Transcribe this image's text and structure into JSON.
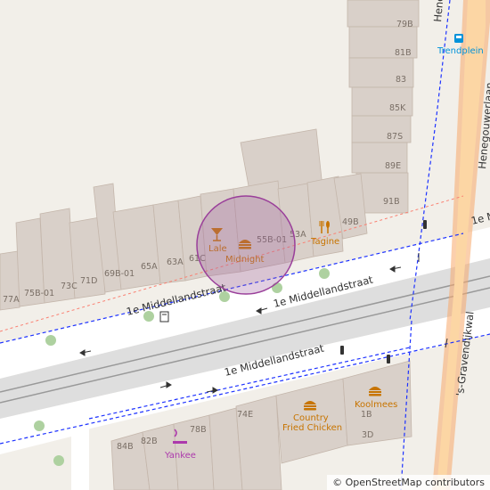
{
  "map": {
    "streets": {
      "middellandstraat_top_left": "1e Middellandstraat",
      "middellandstraat_top_mid": "1e Middellandstraat",
      "middellandstraat_bottom": "1e Middellandstraat",
      "middellandstraat_right": "1e M",
      "henegouwerlaan": "Henegouwerlaan",
      "henegouwerlaan_top": "Hene",
      "s_gravendijkwal": "'s-Gravendijkwal"
    },
    "house_numbers": {
      "n79B": "79B",
      "n81B": "81B",
      "n83": "83",
      "n85K": "85K",
      "n87S": "87S",
      "n89E": "89E",
      "n91B": "91B",
      "n49B": "49B",
      "n53A": "53A",
      "n55B01": "55B-01",
      "n61C": "61C",
      "n63A": "63A",
      "n65A": "65A",
      "n69B01": "69B-01",
      "n71D": "71D",
      "n73C": "73C",
      "n75B01": "75B-01",
      "n77A": "77A",
      "n74E": "74E",
      "n78B": "78B",
      "n82B": "82B",
      "n84B": "84B",
      "n1B": "1B",
      "n3D": "3D"
    },
    "pois": {
      "lale": "Lale",
      "midnight": "Midnight",
      "tagine": "Tagine",
      "trendplein": "Trendplein",
      "country_fried_chicken_1": "Country",
      "country_fried_chicken_2": "Fried Chicken",
      "koolmees": "Koolmees",
      "yankee": "Yankee"
    },
    "colors": {
      "background": "#f2efe9",
      "building": "#d9d0c9",
      "road_major": "#f7fabf",
      "road_white": "#ffffff",
      "cycleway": "#1d32ff",
      "marker_fill": "#a060a0",
      "food": "#c77400",
      "shop": "#ac39ac",
      "transit": "#0092da"
    },
    "icons": [
      "cocktail-icon",
      "burger-icon",
      "cutlery-icon",
      "bus-stop-icon",
      "shopping-icon",
      "traffic-signal-icon",
      "charging-icon"
    ]
  },
  "attribution": {
    "symbol": "©",
    "text": "OpenStreetMap contributors"
  }
}
